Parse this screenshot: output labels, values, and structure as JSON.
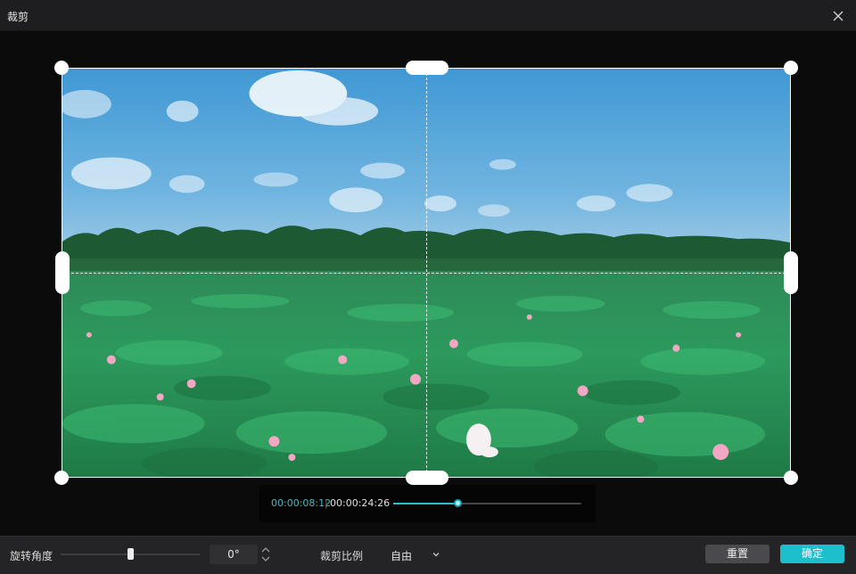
{
  "window": {
    "title": "裁剪",
    "close_icon": "close-icon"
  },
  "preview": {
    "image_description": "lotus-pond-under-blue-sky"
  },
  "playback": {
    "current_time": "00:00:08:12",
    "separator": "|",
    "total_time": "00:00:24:26",
    "progress": 0.34
  },
  "toolbar": {
    "rotation_label": "旋转角度",
    "rotation_value": "0°",
    "rotation_slider_position": 0.5,
    "ratio_label": "裁剪比例",
    "ratio_value": "自由",
    "reset_label": "重置",
    "confirm_label": "确定"
  },
  "colors": {
    "accent": "#1ebfcd",
    "timecode": "#4fb6bd"
  }
}
